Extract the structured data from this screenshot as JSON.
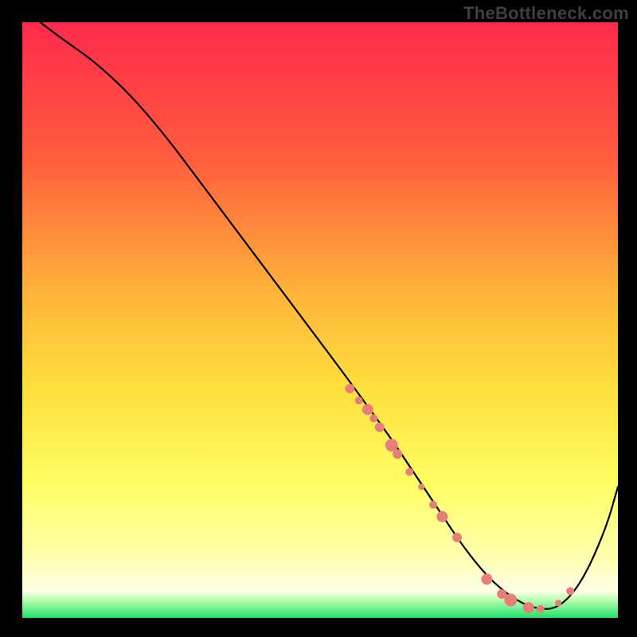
{
  "watermark": "TheBottleneck.com",
  "chart_data": {
    "type": "line",
    "title": "",
    "xlabel": "",
    "ylabel": "",
    "xlim": [
      0,
      100
    ],
    "ylim": [
      0,
      100
    ],
    "grid": false,
    "legend": false,
    "background_gradient": {
      "stops": [
        {
          "offset": 0.0,
          "color": "#ff2a4d"
        },
        {
          "offset": 0.22,
          "color": "#ff5a3d"
        },
        {
          "offset": 0.45,
          "color": "#ffb23a"
        },
        {
          "offset": 0.62,
          "color": "#ffe13d"
        },
        {
          "offset": 0.78,
          "color": "#ffff66"
        },
        {
          "offset": 0.9,
          "color": "#ffffb0"
        },
        {
          "offset": 0.955,
          "color": "#ffffe6"
        },
        {
          "offset": 0.97,
          "color": "#b8ffb0"
        },
        {
          "offset": 1.0,
          "color": "#1fe06a"
        }
      ]
    },
    "series": [
      {
        "name": "bottleneck-curve",
        "color": "#000000",
        "width": 2.2,
        "x": [
          3,
          7,
          12,
          18,
          24,
          30,
          36,
          42,
          48,
          54,
          58,
          62,
          66,
          70,
          74,
          78,
          82,
          86,
          90,
          94,
          98,
          100
        ],
        "y": [
          100,
          97,
          93.5,
          88,
          81,
          73,
          65,
          57,
          49,
          41,
          35.5,
          30,
          24,
          18,
          12,
          7,
          3.5,
          1.5,
          1.5,
          6,
          15,
          22
        ]
      }
    ],
    "markers": {
      "name": "highlight-points",
      "color": "#e77f78",
      "x": [
        55,
        56.5,
        58,
        59,
        60,
        62,
        63,
        65,
        67,
        69,
        70.5,
        73,
        78,
        80.5,
        82,
        85,
        87,
        90,
        92
      ],
      "y": [
        38.5,
        36.5,
        35,
        33.5,
        32,
        29,
        27.5,
        24.5,
        22,
        19,
        17,
        13.5,
        6.5,
        4,
        3,
        1.7,
        1.5,
        2.5,
        4.5
      ],
      "r": [
        6,
        5,
        7,
        5,
        6,
        8,
        6,
        5,
        4,
        5,
        7,
        6,
        7,
        6,
        8,
        7,
        5,
        4,
        5
      ]
    }
  }
}
